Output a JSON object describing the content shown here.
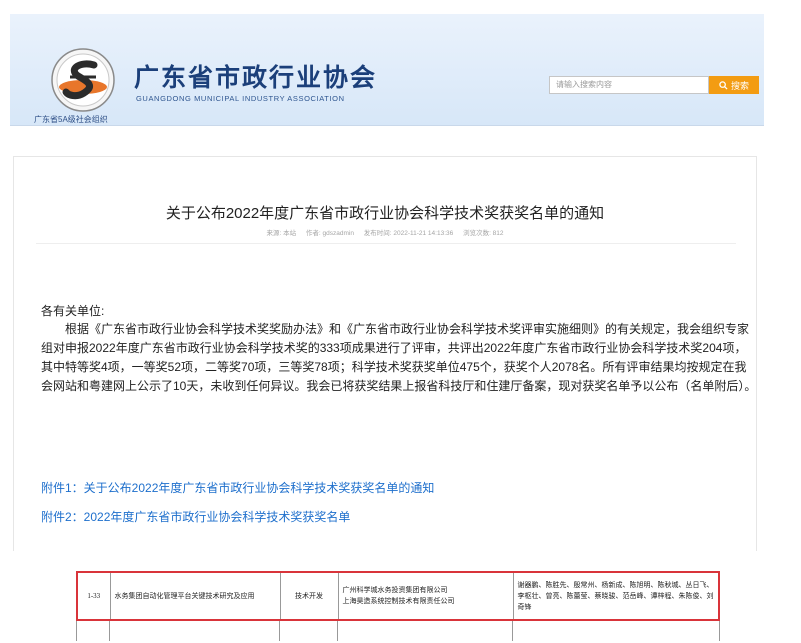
{
  "header": {
    "site_name": "广东省市政行业协会",
    "site_name_en": "GUANGDONG MUNICIPAL INDUSTRY ASSOCIATION",
    "org_grade": "广东省5A级社会组织",
    "search_placeholder": "请输入搜索内容",
    "search_button": "搜索",
    "brand_color": "#1b3f7a",
    "accent_color": "#f39c12"
  },
  "article": {
    "title": "关于公布2022年度广东省市政行业协会科学技术奖获奖名单的通知",
    "meta": {
      "source": "来源: 本站",
      "author": "作者: gdszadmin",
      "published": "发布时间: 2022-11-21 14:13:36",
      "views": "浏览次数: 812"
    },
    "salutation": "各有关单位:",
    "body": "根据《广东省市政行业协会科学技术奖奖励办法》和《广东省市政行业协会科学技术奖评审实施细则》的有关规定，我会组织专家组对申报2022年度广东省市政行业协会科学技术奖的333项成果进行了评审，共评出2022年度广东省市政行业协会科学技术奖204项，其中特等奖4项，一等奖52项，二等奖70项，三等奖78项；科学技术奖获奖单位475个，获奖个人2078名。所有评审结果均按规定在我会网站和粤建网上公示了10天，未收到任何异议。我会已将获奖结果上报省科技厅和住建厅备案，现对获奖名单予以公布（名单附后）。",
    "attachments": [
      "附件1：关于公布2022年度广东省市政行业协会科学技术奖获奖名单的通知",
      "附件2：2022年度广东省市政行业协会科学技术奖获奖名单"
    ],
    "link_color": "#1e6fcc"
  },
  "table_fragment": {
    "row": {
      "no": "1-33",
      "project": "水务集团自动化管理平台关键技术研究及应用",
      "category": "技术开发",
      "units": [
        "广州科学城水务投资集团有限公司",
        "上海昊造系统控制技术有限责任公司"
      ],
      "people": "谢器鹏、陈胜先、殷常州、杨新成、陈旭明、陈秋城、丛日飞、李枢壮、曾亮、陈蕾莹、蔡晓骏、范岳峰、谭梓程、朱陈俊、刘奇锋"
    },
    "highlight_color": "#d9343a"
  }
}
